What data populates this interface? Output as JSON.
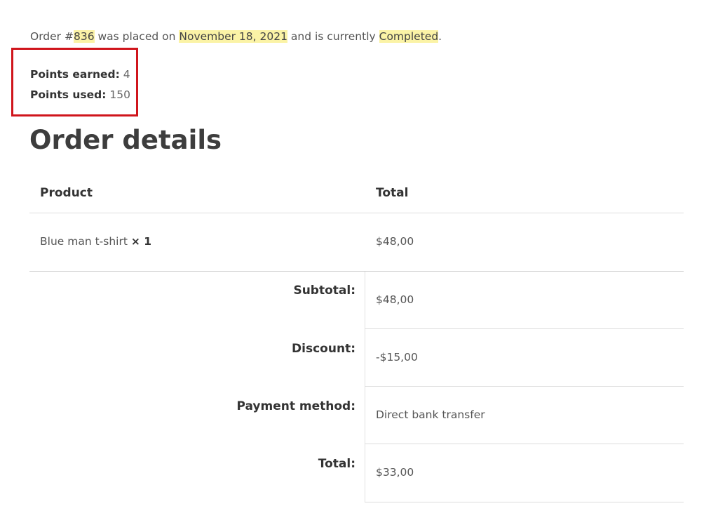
{
  "order_status": {
    "prefix": "Order #",
    "number": "836",
    "placed_text": " was placed on ",
    "date": "November 18, 2021",
    "status_text": " and is currently ",
    "status": "Completed",
    "suffix": "."
  },
  "points": {
    "earned_label": "Points earned:",
    "earned_value": "4",
    "used_label": "Points used:",
    "used_value": "150"
  },
  "order_details": {
    "title": "Order details",
    "columns": [
      "Product",
      "Total"
    ],
    "items": [
      {
        "product": "Blue man t-shirt",
        "quantity": "× 1",
        "total": "$48,00"
      }
    ],
    "totals": [
      {
        "label": "Subtotal:",
        "value": "$48,00"
      },
      {
        "label": "Discount:",
        "value": "-$15,00"
      },
      {
        "label": "Payment method:",
        "value": "Direct bank transfer"
      },
      {
        "label": "Total:",
        "value": "$33,00"
      }
    ]
  },
  "colors": {
    "highlight": "#fbf3a6",
    "annotation_border": "#d0151c"
  }
}
